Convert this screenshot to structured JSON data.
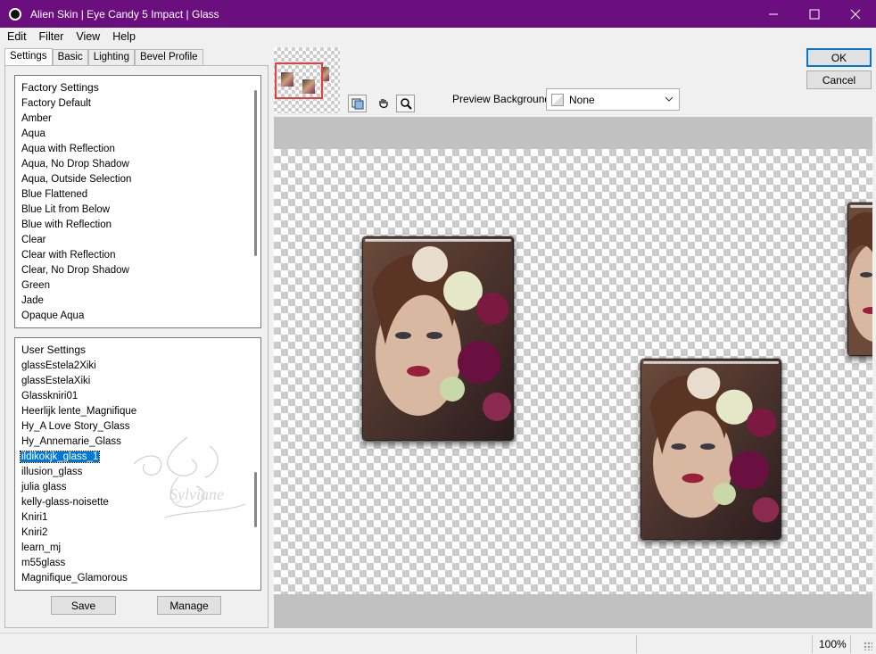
{
  "window": {
    "title": "Alien Skin | Eye Candy 5 Impact | Glass",
    "title_bar_color": "#6b0f7e"
  },
  "menu": [
    {
      "label": "Edit"
    },
    {
      "label": "Filter"
    },
    {
      "label": "View"
    },
    {
      "label": "Help"
    }
  ],
  "tabs": [
    {
      "label": "Settings",
      "active": true
    },
    {
      "label": "Basic"
    },
    {
      "label": "Lighting"
    },
    {
      "label": "Bevel Profile"
    }
  ],
  "factory_settings": {
    "header": "Factory Settings",
    "items": [
      "Factory Default",
      "Amber",
      "Aqua",
      "Aqua with Reflection",
      "Aqua, No Drop Shadow",
      "Aqua, Outside Selection",
      "Blue Flattened",
      "Blue Lit from Below",
      "Blue with Reflection",
      "Clear",
      "Clear with Reflection",
      "Clear, No Drop Shadow",
      "Green",
      "Jade",
      "Opaque Aqua"
    ]
  },
  "user_settings": {
    "header": "User Settings",
    "items": [
      "glassEstela2Xiki",
      "glassEstelaXiki",
      "Glasskniri01",
      "Heerlijk lente_Magnifique",
      "Hy_A Love Story_Glass",
      "Hy_Annemarie_Glass",
      "ildikokjk_glass_1",
      "illusion_glass",
      "julia glass",
      "kelly-glass-noisette",
      "Kniri1",
      "Kniri2",
      "learn_mj",
      "m55glass",
      "Magnifique_Glamorous"
    ],
    "selected": "ildikokjk_glass_1"
  },
  "buttons": {
    "save": "Save",
    "manage": "Manage",
    "ok": "OK",
    "cancel": "Cancel"
  },
  "toolbar": {
    "tools": [
      "preview-toggle-icon",
      "hand-icon",
      "zoom-icon"
    ]
  },
  "preview_background": {
    "label": "Preview Background:",
    "value": "None"
  },
  "status": {
    "zoom": "100%"
  },
  "accent": "#0078d7"
}
